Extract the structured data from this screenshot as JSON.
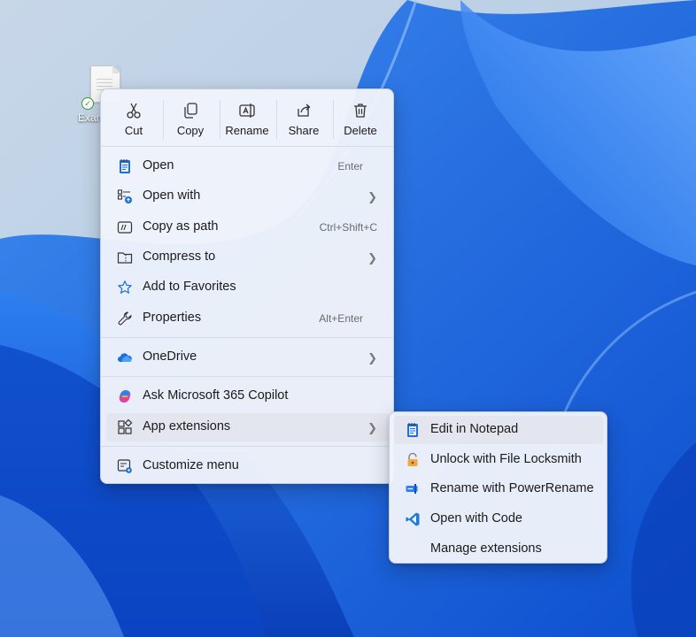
{
  "desktop": {
    "file_label": "Exan"
  },
  "toolbar": {
    "cut": "Cut",
    "copy": "Copy",
    "rename": "Rename",
    "share": "Share",
    "delete": "Delete"
  },
  "menu": {
    "open": {
      "label": "Open",
      "shortcut": "Enter"
    },
    "open_with": {
      "label": "Open with"
    },
    "copy_as_path": {
      "label": "Copy as path",
      "shortcut": "Ctrl+Shift+C"
    },
    "compress_to": {
      "label": "Compress to"
    },
    "add_to_favorites": {
      "label": "Add to Favorites"
    },
    "properties": {
      "label": "Properties",
      "shortcut": "Alt+Enter"
    },
    "onedrive": {
      "label": "OneDrive"
    },
    "copilot": {
      "label": "Ask Microsoft 365 Copilot"
    },
    "app_extensions": {
      "label": "App extensions"
    },
    "customize": {
      "label": "Customize menu"
    }
  },
  "submenu": {
    "edit_notepad": "Edit in Notepad",
    "unlock_locksmith": "Unlock with File Locksmith",
    "rename_powerrename": "Rename with PowerRename",
    "open_with_code": "Open with Code",
    "manage_extensions": "Manage extensions"
  },
  "colors": {
    "accent": "#1f5fbf",
    "wallpaper_base": "#1565e0",
    "menu_bg": "#f0f3fa"
  }
}
